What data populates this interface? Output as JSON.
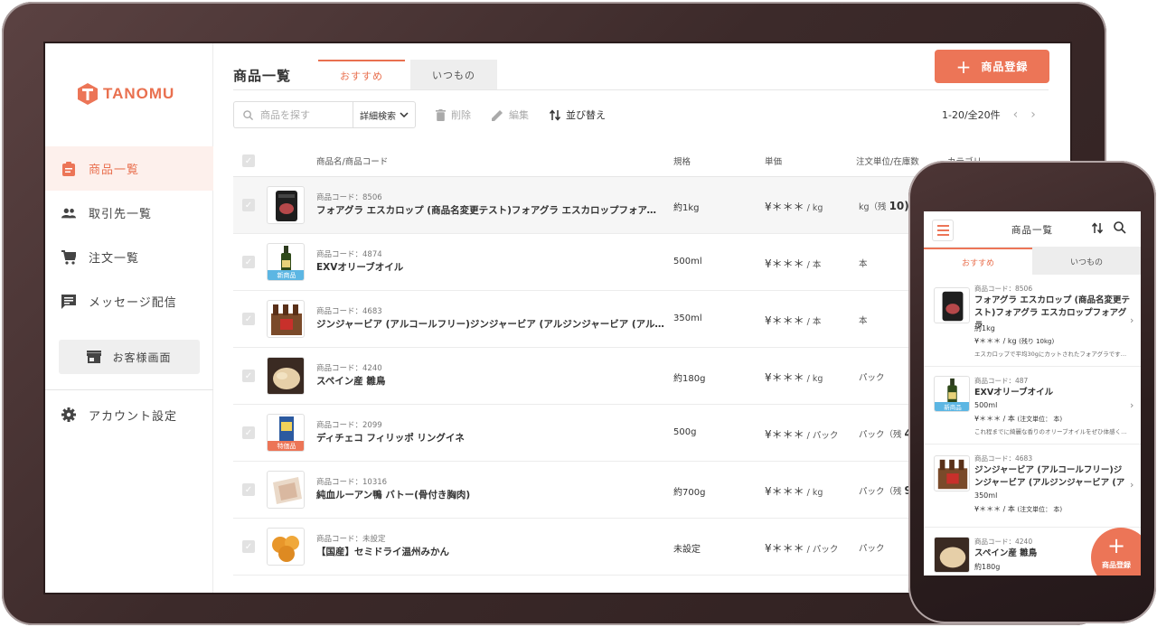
{
  "app": {
    "brand": "TANOMU"
  },
  "colors": {
    "accent": "#ec7557",
    "new_badge": "#5cb6e3"
  },
  "sidebar": {
    "items": [
      {
        "label": "商品一覧",
        "icon": "clipboard-icon",
        "active": true
      },
      {
        "label": "取引先一覧",
        "icon": "people-icon",
        "active": false
      },
      {
        "label": "注文一覧",
        "icon": "cart-icon",
        "active": false
      },
      {
        "label": "メッセージ配信",
        "icon": "message-icon",
        "active": false
      }
    ],
    "customer_button": "お客様画面",
    "account": "アカウント設定"
  },
  "header": {
    "title": "商品一覧",
    "tabs": [
      {
        "label": "おすすめ",
        "active": true
      },
      {
        "label": "いつもの",
        "active": false
      }
    ],
    "register_button": "商品登録"
  },
  "toolbar": {
    "search_placeholder": "商品を探す",
    "advanced_search": "詳細検索",
    "delete": "削除",
    "edit": "編集",
    "sort": "並び替え",
    "pagination": "1-20/全20件"
  },
  "table": {
    "headers": [
      "商品名/商品コード",
      "規格",
      "単価",
      "注文単位/在庫数",
      "カテゴリ"
    ],
    "rows": [
      {
        "code": "商品コード：8506",
        "name": "フォアグラ エスカロップ (商品名変更テスト)フォアグラ エスカロップフォアグ…",
        "spec": "約1kg",
        "price": "¥＊＊＊",
        "unit": " / kg",
        "order_unit": "kg（残",
        "stock": "10)",
        "badge": ""
      },
      {
        "code": "商品コード：4874",
        "name": "EXVオリーブオイル",
        "spec": "500ml",
        "price": "¥＊＊＊",
        "unit": " / 本",
        "order_unit": "本",
        "stock": "",
        "badge": "新商品"
      },
      {
        "code": "商品コード：4683",
        "name": "ジンジャービア (アルコールフリー)ジンジャービア (アルジンジャービア (アルコ…",
        "spec": "350ml",
        "price": "¥＊＊＊",
        "unit": " / 本",
        "order_unit": "本",
        "stock": "",
        "badge": ""
      },
      {
        "code": "商品コード：4240",
        "name": "スペイン産 雛鳥",
        "spec": "約180g",
        "price": "¥＊＊＊",
        "unit": " / kg",
        "order_unit": "パック",
        "stock": "",
        "badge": ""
      },
      {
        "code": "商品コード：2099",
        "name": "ディチェコ フィリッポ リングイネ",
        "spec": "500g",
        "price": "¥＊＊＊",
        "unit": " / パック",
        "order_unit": "パック（残",
        "stock": "4",
        "badge": "特価品"
      },
      {
        "code": "商品コード：10316",
        "name": "純血ルーアン鴨 バトー(骨付き胸肉)",
        "spec": "約700g",
        "price": "¥＊＊＊",
        "unit": " / kg",
        "order_unit": "パック（残",
        "stock": "9",
        "badge": ""
      },
      {
        "code": "商品コード：未設定",
        "name": "【国産】セミドライ温州みかん",
        "spec": "未設定",
        "price": "¥＊＊＊",
        "unit": " / パック",
        "order_unit": "パック",
        "stock": "",
        "badge": ""
      }
    ]
  },
  "phone": {
    "title": "商品一覧",
    "tabs": [
      "おすすめ",
      "いつもの"
    ],
    "items": [
      {
        "code": "商品コード：8506",
        "name": "フォアグラ エスカロップ (商品名変更テスト)フォアグラ エスカロップフォアグラ",
        "spec": "約1kg",
        "price": "¥＊＊＊ / kg",
        "stock": "(残り 10kg)",
        "desc": "エスカロップで平均30gにカットされたフォアグラです…"
      },
      {
        "code": "商品コード：487",
        "name": "EXVオリーブオイル",
        "spec": "500ml",
        "price": "¥＊＊＊ / 本",
        "stock": "(注文単位： 本)",
        "desc": "これ程までに綺麗な香りのオリーブオイルをぜひ体感く…",
        "badge": "新商品"
      },
      {
        "code": "商品コード：4683",
        "name": "ジンジャービア (アルコールフリー)ジンジャービア (アルジンジャービア (アルコ",
        "spec": "350ml",
        "price": "¥＊＊＊ / 本",
        "stock": "(注文単位： 本)"
      },
      {
        "code": "商品コード：4240",
        "name": "スペイン産 雛鳥",
        "spec": "約180g"
      }
    ],
    "fab_label": "商品登録"
  }
}
